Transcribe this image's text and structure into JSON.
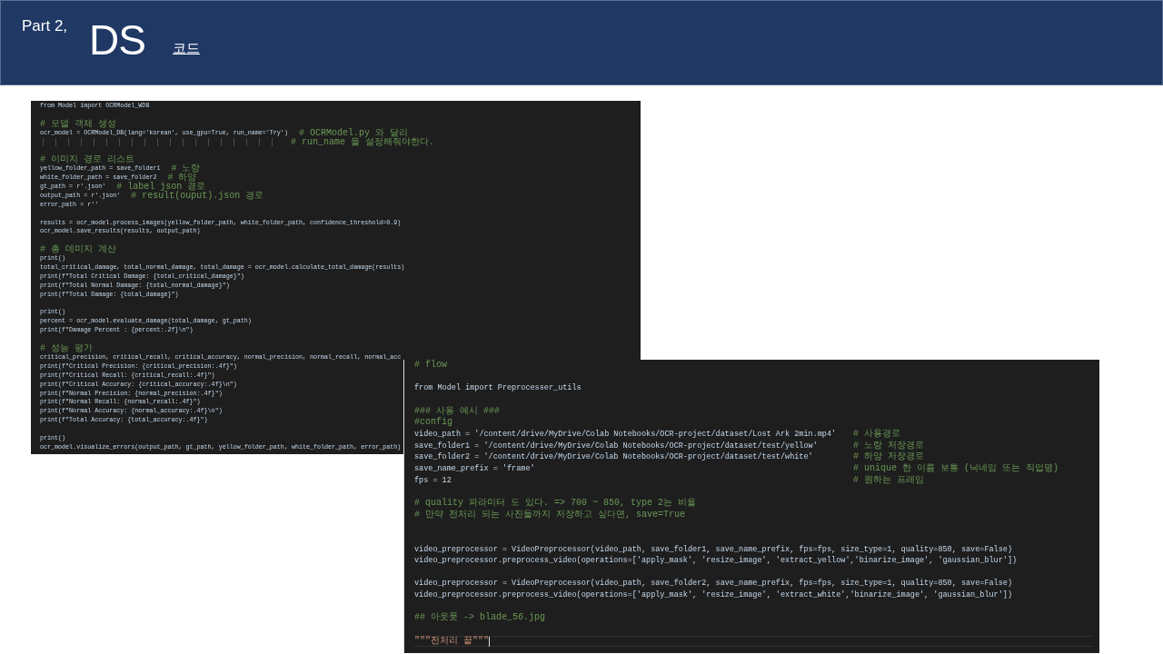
{
  "header": {
    "part": "Part 2,",
    "title": "DS",
    "link": "코드"
  },
  "editors": [
    {
      "lines": [
        {
          "kind": "code",
          "code": "from Model import OCRModel_WDB"
        },
        {
          "kind": "blank"
        },
        {
          "kind": "comment",
          "comment": "# 모델 객체 생성"
        },
        {
          "kind": "code",
          "code": "ocr_model = OCRModel_DB(lang='korean', use_gpu=True, run_name='Try')",
          "comment": "# OCRModel.py 와 달리"
        },
        {
          "kind": "guides",
          "comment": "# run_name 을 설정해줘야한다."
        },
        {
          "kind": "blank"
        },
        {
          "kind": "comment",
          "comment": "# 이미지 경로 리스트"
        },
        {
          "kind": "code",
          "code": "yellow_folder_path = save_folder1",
          "comment": "# 노랑"
        },
        {
          "kind": "code",
          "code": "white_folder_path = save_folder2",
          "comment": "# 하양"
        },
        {
          "kind": "code",
          "code": "gt_path = r'.json'",
          "comment": "# label json 경로"
        },
        {
          "kind": "code",
          "code": "output_path = r'.json'",
          "comment": "# result(ouput).json 경로"
        },
        {
          "kind": "code",
          "code": "error_path = r''"
        },
        {
          "kind": "blank"
        },
        {
          "kind": "code",
          "code": "results = ocr_model.process_images(yellow_folder_path, white_folder_path, confidence_threshold=0.9)"
        },
        {
          "kind": "code",
          "code": "ocr_model.save_results(results, output_path)"
        },
        {
          "kind": "blank"
        },
        {
          "kind": "comment",
          "comment": "# 총 데미지 계산"
        },
        {
          "kind": "code",
          "code": "print()"
        },
        {
          "kind": "code",
          "code": "total_critical_damage, total_normal_damage, total_damage = ocr_model.calculate_total_damage(results)"
        },
        {
          "kind": "code",
          "code": "print(f\"Total Critical Damage: {total_critical_damage}\")"
        },
        {
          "kind": "code",
          "code": "print(f\"Total Normal Damage: {total_normal_damage}\")"
        },
        {
          "kind": "code",
          "code": "print(f\"Total Damage: {total_damage}\")"
        },
        {
          "kind": "blank"
        },
        {
          "kind": "code",
          "code": "print()"
        },
        {
          "kind": "code",
          "code": "percent = ocr_model.evaluate_damage(total_damage, gt_path)"
        },
        {
          "kind": "code",
          "code": "print(f\"Damage Percent : {percent:.2f}\\n\")"
        },
        {
          "kind": "blank"
        },
        {
          "kind": "comment",
          "comment": "# 성능 평가"
        },
        {
          "kind": "code",
          "code": "critical_precision, critical_recall, critical_accuracy, normal_precision, normal_recall, normal_acc"
        },
        {
          "kind": "code",
          "code": "print(f\"Critical Precision: {critical_precision:.4f}\")"
        },
        {
          "kind": "code",
          "code": "print(f\"Critical Recall: {critical_recall:.4f}\")"
        },
        {
          "kind": "code",
          "code": "print(f\"Critical Accuracy: {critical_accuracy:.4f}\\n\")"
        },
        {
          "kind": "code",
          "code": "print(f\"Normal Precision: {normal_precision:.4f}\")"
        },
        {
          "kind": "code",
          "code": "print(f\"Normal Recall: {normal_recall:.4f}\")"
        },
        {
          "kind": "code",
          "code": "print(f\"Normal Accuracy: {normal_accuracy:.4f}\\n\")"
        },
        {
          "kind": "code",
          "code": "print(f\"Total Accuracy: {total_accuracy:.4f}\")"
        },
        {
          "kind": "blank"
        },
        {
          "kind": "code",
          "code": "print()"
        },
        {
          "kind": "code",
          "code": "ocr_model.visualize_errors(output_path, gt_path, yellow_folder_path, white_folder_path, error_path)"
        }
      ]
    },
    {
      "lines": [
        {
          "kind": "comment",
          "comment": "# flow"
        },
        {
          "kind": "blank"
        },
        {
          "kind": "code",
          "code": "from Model import Preprocesser_utils"
        },
        {
          "kind": "blank"
        },
        {
          "kind": "comment",
          "comment": "### 사용 예시 ###"
        },
        {
          "kind": "comment",
          "comment": "#config"
        },
        {
          "kind": "code",
          "code": "video_path = '/content/drive/MyDrive/Colab Notebooks/OCR-project/dataset/Lost Ark 2min.mp4'",
          "comment": "# 사용경로"
        },
        {
          "kind": "code",
          "code": "save_folder1 = '/content/drive/MyDrive/Colab Notebooks/OCR-project/dataset/test/yellow'",
          "comment": "# 노랑 저장경로"
        },
        {
          "kind": "code",
          "code": "save_folder2 = '/content/drive/MyDrive/Colab Notebooks/OCR-project/dataset/test/white'",
          "comment": "# 하양 저장경로"
        },
        {
          "kind": "code",
          "code": "save_name_prefix = 'frame'",
          "comment": "# unique 한 이름 보통 (닉네임 또는 직업명)"
        },
        {
          "kind": "code",
          "code": "fps = 12",
          "comment": "# 원하는 프레임"
        },
        {
          "kind": "blank"
        },
        {
          "kind": "comment",
          "comment": "# quality 파라미터 도 있다. => 700 ~ 850, type 2는 비율"
        },
        {
          "kind": "comment",
          "comment": "# 만약 전처리 되는 사진들까지 저장하고 싶다면, save=True"
        },
        {
          "kind": "blank"
        },
        {
          "kind": "blank"
        },
        {
          "kind": "code",
          "code": "video_preprocessor = VideoPreprocessor(video_path, save_folder1, save_name_prefix, fps=fps, size_type=1, quality=850, save=False)"
        },
        {
          "kind": "code",
          "code": "video_preprocessor.preprocess_video(operations=['apply_mask', 'resize_image', 'extract_yellow','binarize_image', 'gaussian_blur'])"
        },
        {
          "kind": "blank"
        },
        {
          "kind": "code",
          "code": "video_preprocessor = VideoPreprocessor(video_path, save_folder2, save_name_prefix, fps=fps, size_type=1, quality=850, save=False)"
        },
        {
          "kind": "code",
          "code": "video_preprocessor.preprocess_video(operations=['apply_mask', 'resize_image', 'extract_white','binarize_image', 'gaussian_blur'])"
        },
        {
          "kind": "blank"
        },
        {
          "kind": "comment",
          "comment": "## 아웃풋 -> blade_56.jpg"
        },
        {
          "kind": "blank"
        },
        {
          "kind": "current",
          "code": "\"\"\"전처리 끝\"\"\""
        }
      ]
    }
  ]
}
